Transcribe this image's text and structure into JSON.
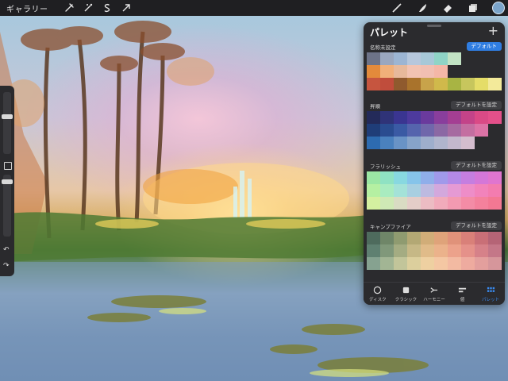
{
  "topbar": {
    "gallery_label": "ギャラリー",
    "left_icons": [
      "wrench-icon",
      "magic-wand-icon",
      "selection-icon",
      "transform-arrow-icon"
    ],
    "right_icons": [
      "brush-icon",
      "smudge-icon",
      "eraser-icon",
      "layers-icon"
    ],
    "current_color": "#7aa3c9"
  },
  "panel": {
    "title": "パレット",
    "add_label": "+",
    "palettes": [
      {
        "name": "名称未設定",
        "button": "デフォルト",
        "is_default": true,
        "rows": [
          [
            "#6d7388",
            "#9aa7bf",
            "#9cb5d3",
            "#b6c7dc",
            "#a7c8d8",
            "#8fd4c6",
            "#c2e3c4",
            null,
            null,
            null
          ],
          [
            "#e38a3b",
            "#f1b07a",
            "#e7b99b",
            "#f2c3b2",
            "#f1bfb2",
            "#f4b7a7",
            null,
            null,
            null,
            null
          ],
          [
            "#c6553f",
            "#c04d3c",
            "#8f5a2e",
            "#a9732c",
            "#c8a34a",
            "#d0b94b",
            "#a8b443",
            "#c7c65d",
            "#e5dd68",
            "#f3ea9a"
          ]
        ]
      },
      {
        "name": "昇順",
        "button": "デフォルトを設定",
        "is_default": false,
        "rows": [
          [
            "#232a59",
            "#2f3378",
            "#3a3591",
            "#4d3a9d",
            "#6a3a9d",
            "#893e9c",
            "#a43e93",
            "#c34389",
            "#da4a86",
            "#e4508a"
          ],
          [
            "#1f3d78",
            "#2a4c90",
            "#3a5aa4",
            "#5564ad",
            "#7067ab",
            "#8b68a4",
            "#a66aa1",
            "#c46ea1",
            "#dc73a6",
            null
          ],
          [
            "#2d6bb0",
            "#4a81be",
            "#6993c6",
            "#86a3c9",
            "#9eaecc",
            "#b0b5cd",
            "#c3b8cd",
            "#d4bdce",
            null,
            null
          ]
        ]
      },
      {
        "name": "フラリッシュ",
        "button": "デフォルトを設定",
        "is_default": false,
        "rows": [
          [
            "#9be7a4",
            "#8fe2c3",
            "#88d8e0",
            "#86c4ea",
            "#8faeea",
            "#a099ea",
            "#b389e6",
            "#c57ee0",
            "#d477d8",
            "#e075cf"
          ],
          [
            "#b5f0a2",
            "#a9ecc0",
            "#a4e2d8",
            "#a8cfe1",
            "#bdbae0",
            "#d3a8dd",
            "#e59ad4",
            "#ee8dc8",
            "#f283bb",
            "#f37caf"
          ],
          [
            "#d4f0a0",
            "#cfe9b5",
            "#d9dcc3",
            "#e4cdc8",
            "#ecbcc3",
            "#f1abbb",
            "#f39ab1",
            "#f48ca6",
            "#f4819c",
            "#f37893"
          ]
        ]
      },
      {
        "name": "キャンプファイア",
        "button": "デフォルトを設定",
        "is_default": false,
        "rows": [
          [
            "#4e6b5d",
            "#6f8668",
            "#8f9b70",
            "#b3a874",
            "#d1ad78",
            "#dfa37a",
            "#e0927a",
            "#d98079",
            "#c96f77",
            "#b56476"
          ],
          [
            "#5f8071",
            "#80987a",
            "#a4ac82",
            "#c6b886",
            "#e0bb89",
            "#ebb28b",
            "#eca28b",
            "#e5918a",
            "#d68189",
            "#c47788"
          ],
          [
            "#86a290",
            "#a2b594",
            "#c2c59a",
            "#dccf9d",
            "#eed0a1",
            "#f4c7a3",
            "#f3baa2",
            "#eeab9f",
            "#e39f9d",
            "#d6969b"
          ]
        ]
      }
    ],
    "nav": [
      {
        "label": "ディスク",
        "icon": "disc-icon",
        "active": false
      },
      {
        "label": "クラシック",
        "icon": "classic-square-icon",
        "active": false
      },
      {
        "label": "ハーモニー",
        "icon": "harmony-icon",
        "active": false
      },
      {
        "label": "値",
        "icon": "value-sliders-icon",
        "active": false
      },
      {
        "label": "パレット",
        "icon": "palette-grid-icon",
        "active": true
      }
    ]
  }
}
